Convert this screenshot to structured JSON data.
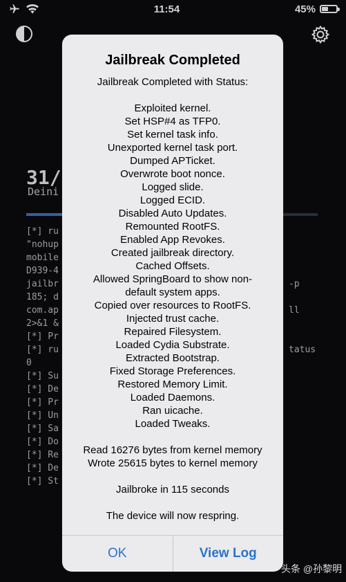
{
  "status_bar": {
    "time": "11:54",
    "battery_percent": "45%",
    "battery_level": 0.45,
    "icons": [
      "airplane-icon",
      "wifi-icon",
      "battery-icon"
    ]
  },
  "background": {
    "progress": "31/",
    "subtitle": "Deini",
    "progress_fraction": 0.35,
    "log_lines": [
      "[*] ru",
      "\"nohup",
      "mobile",
      "D939-4",
      "jailbr",
      "185; d",
      "com.ap",
      "2>&1 &",
      "[*] Pr",
      "[*] ru",
      "0",
      "[*] Su",
      "[*] De",
      "[*] Pr",
      "[*] Un",
      "[*] Sa",
      "[*] Do",
      "[*] Re",
      "[*] De",
      "[*] St"
    ],
    "log_right": [
      "",
      "",
      "",
      "",
      "-p",
      "",
      "ll",
      "",
      "",
      "tatus"
    ]
  },
  "alert": {
    "title": "Jailbreak Completed",
    "message_lines": [
      "Jailbreak Completed with Status:",
      "",
      "Exploited kernel.",
      "Set HSP#4 as TFP0.",
      "Set kernel task info.",
      "Unexported kernel task port.",
      "Dumped APTicket.",
      "Overwrote boot nonce.",
      "Logged slide.",
      "Logged ECID.",
      "Disabled Auto Updates.",
      "Remounted RootFS.",
      "Enabled App Revokes.",
      "Created jailbreak directory.",
      "Cached Offsets.",
      "Allowed SpringBoard to show non-",
      "default system apps.",
      "Copied over resources to RootFS.",
      "Injected trust cache.",
      "Repaired Filesystem.",
      "Loaded Cydia Substrate.",
      "Extracted Bootstrap.",
      "Fixed Storage Preferences.",
      "Restored Memory Limit.",
      "Loaded Daemons.",
      "Ran uicache.",
      "Loaded Tweaks.",
      "",
      "Read 16276 bytes from kernel memory",
      "Wrote 25615 bytes to kernel memory",
      "",
      "Jailbroke in 115 seconds",
      "",
      "The device will now respring."
    ],
    "ok_label": "OK",
    "view_log_label": "View Log"
  },
  "watermark": "头条 @孙黎明",
  "colors": {
    "accent": "#2a73c9",
    "alert_bg": "#ebebed",
    "progress": "#3a78c8"
  }
}
